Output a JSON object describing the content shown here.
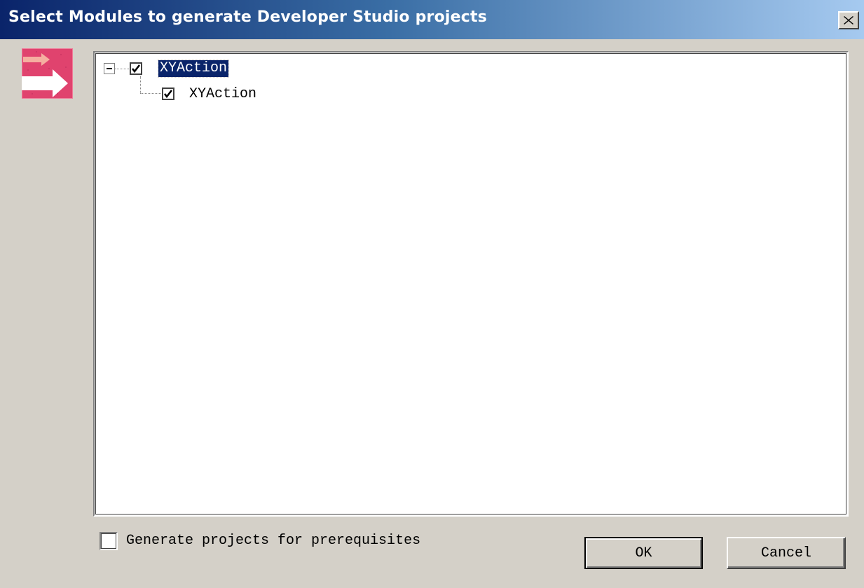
{
  "window": {
    "title": "Select Modules to generate Developer Studio projects",
    "close_glyph": "✕"
  },
  "tree": {
    "root": {
      "label": "XYAction",
      "checked": true,
      "expanded": true,
      "selected": true
    },
    "children": [
      {
        "label": "XYAction",
        "checked": true
      }
    ]
  },
  "footer": {
    "prerequisites_label": "Generate projects for prerequisites",
    "prerequisites_checked": false,
    "ok_label": "OK",
    "cancel_label": "Cancel"
  },
  "colors": {
    "titlebar_start": "#0a246a",
    "titlebar_end": "#a6caf0",
    "dialog_bg": "#d4d0c8",
    "selection_bg": "#0a246a",
    "icon_pink": "#e0436e"
  },
  "icons": {
    "wizard": "arrow-right-icon",
    "checkmark": "checkmark-icon",
    "expander": "minus-box-icon",
    "close": "close-icon"
  }
}
